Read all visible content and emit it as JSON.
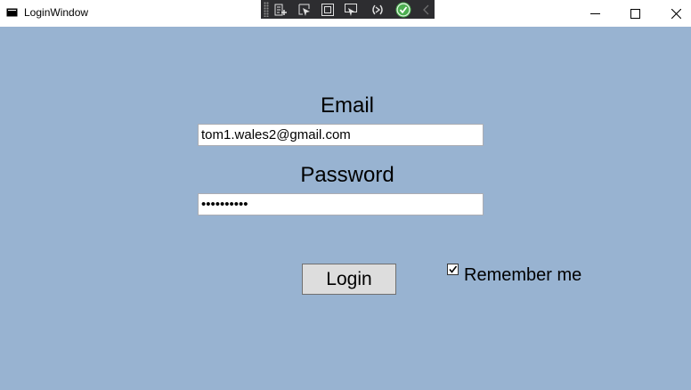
{
  "window": {
    "title": "LoginWindow",
    "background": "#98b3d1"
  },
  "debug_toolbar": {
    "icons": [
      "live-visual-tree-icon",
      "select-element-icon",
      "display-layout-adorners-icon",
      "track-focused-element-icon",
      "hot-reload-icon",
      "binding-failures-ok-icon",
      "collapse-toolbar-icon"
    ]
  },
  "form": {
    "email_label": "Email",
    "email_value": "tom1.wales2@gmail.com",
    "password_label": "Password",
    "password_value": "••••••••••",
    "login_label": "Login",
    "remember_label": "Remember me",
    "remember_checked": true
  }
}
